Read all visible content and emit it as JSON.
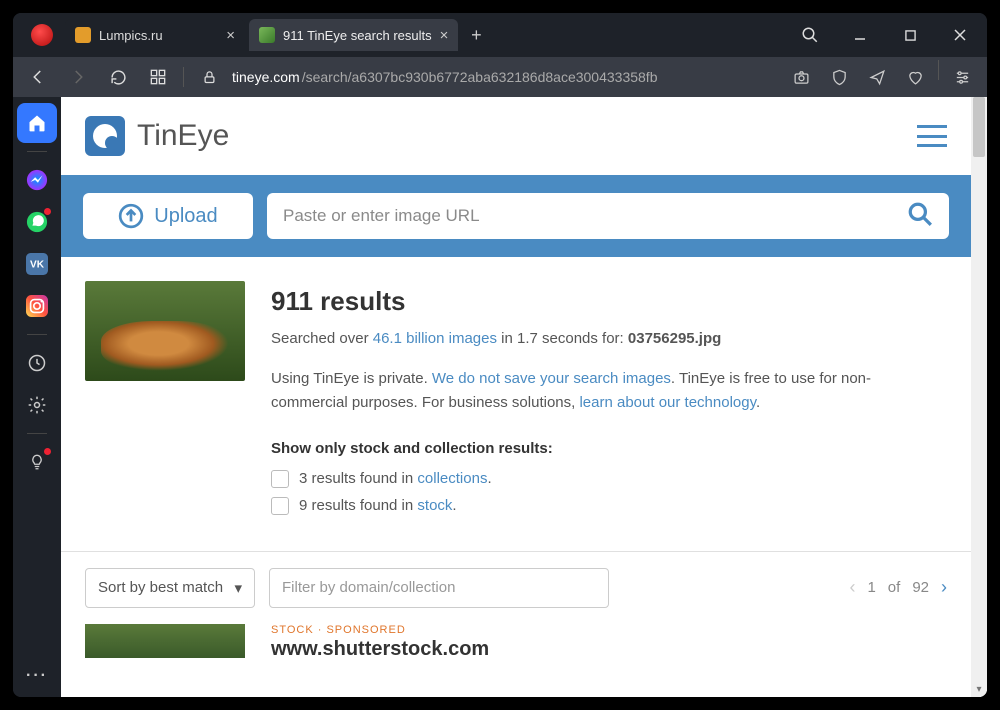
{
  "tabs": [
    {
      "title": "Lumpics.ru",
      "active": false
    },
    {
      "title": "911 TinEye search results",
      "active": true
    }
  ],
  "url": {
    "domain": "tineye.com",
    "path": "/search/a6307bc930b6772aba632186d8ace300433358fb"
  },
  "logo_text": "TinEye",
  "upload_label": "Upload",
  "search_placeholder": "Paste or enter image URL",
  "results": {
    "heading": "911 results",
    "searched_prefix": "Searched over ",
    "index_size": "46.1 billion images",
    "searched_middle": " in 1.7 seconds for: ",
    "filename": "03756295.jpg",
    "privacy_prefix": "Using TinEye is private. ",
    "privacy_link": "We do not save your search images",
    "privacy_suffix": ". TinEye is free to use for non-commercial purposes. For business solutions, ",
    "learn_link": "learn about our technology",
    "period": ".",
    "show_only_label": "Show only stock and collection results:",
    "collections_row": {
      "prefix": "3 results found in ",
      "link": "collections",
      "suffix": "."
    },
    "stock_row": {
      "prefix": "9 results found in ",
      "link": "stock",
      "suffix": "."
    }
  },
  "sort_label": "Sort by best match",
  "filter_placeholder": "Filter by domain/collection",
  "pagination": {
    "current": "1",
    "of_label": "of",
    "total": "92"
  },
  "sponsored": {
    "tag": "STOCK  ·  SPONSORED",
    "site": "www.shutterstock.com"
  }
}
